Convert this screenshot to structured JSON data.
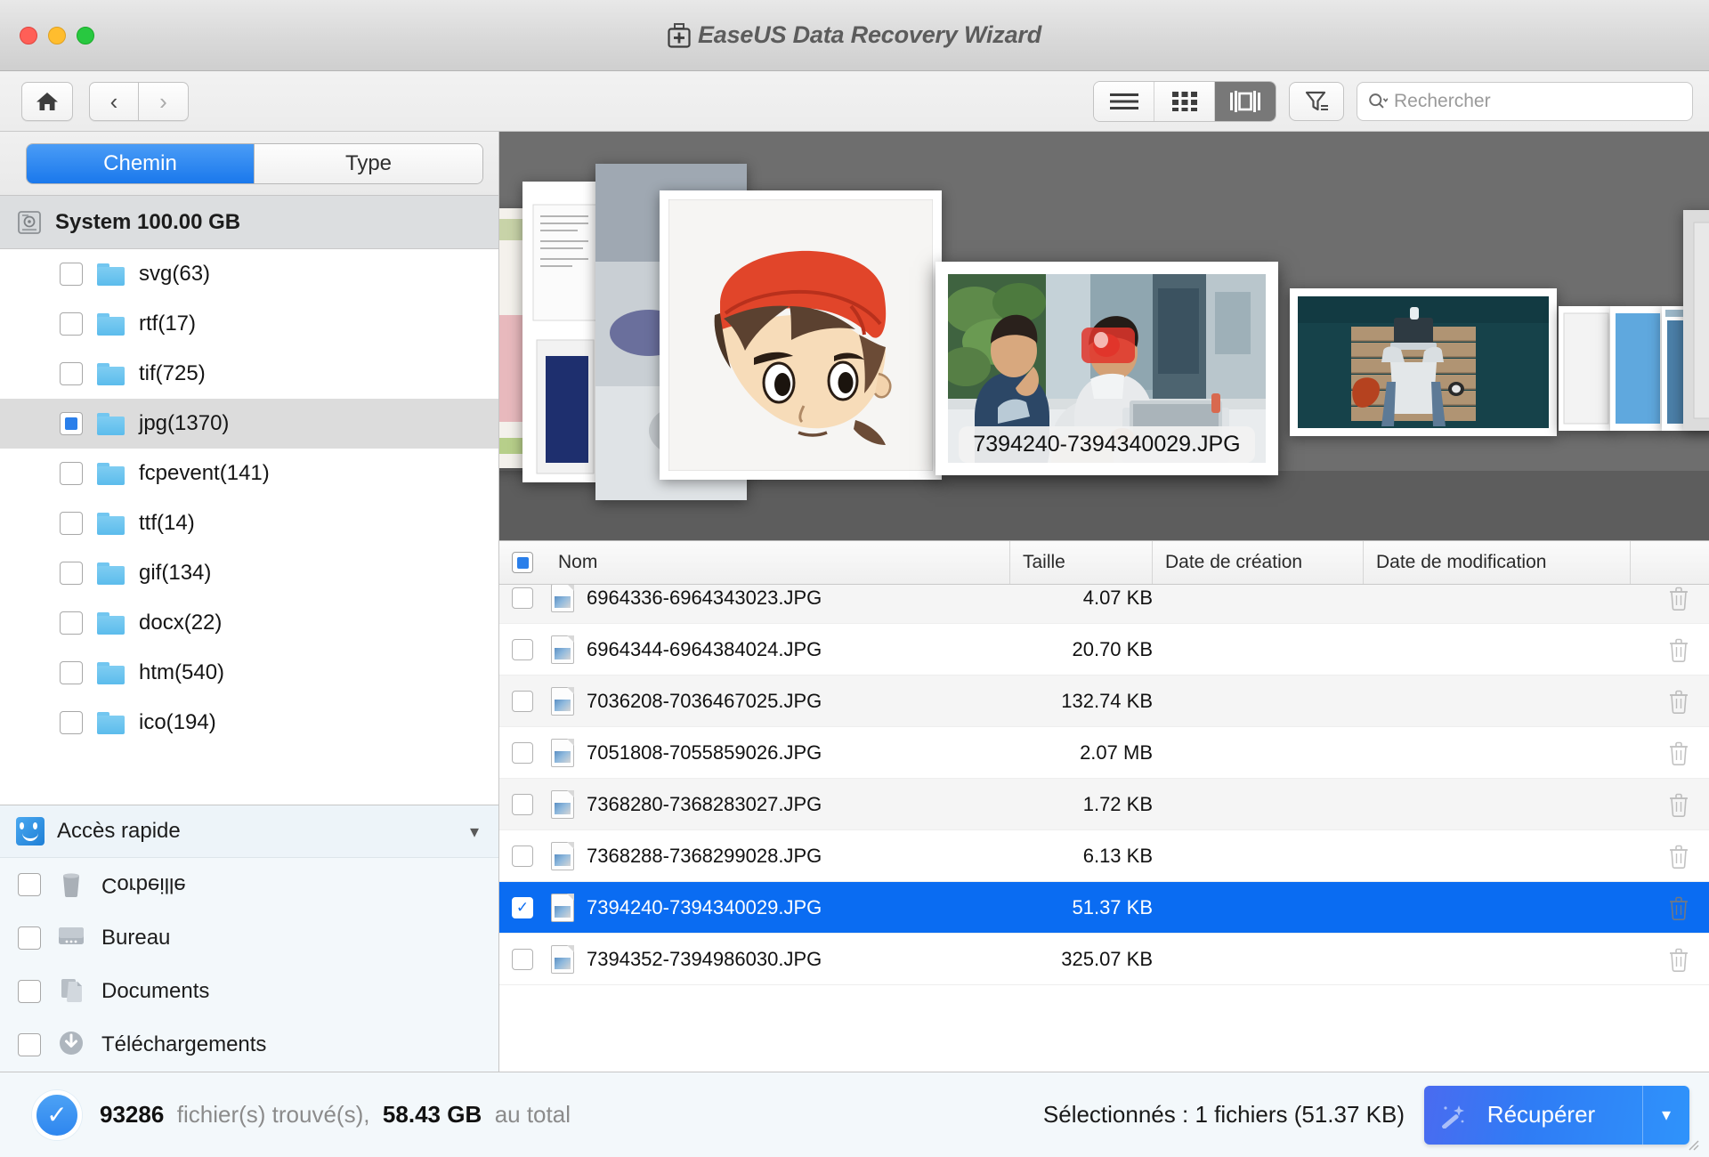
{
  "window": {
    "title": "EaseUS Data Recovery Wizard",
    "title_icon": "first-aid-kit-icon",
    "traffic_lights": [
      "close",
      "minimize",
      "maximize"
    ]
  },
  "toolbar": {
    "home_icon": "home-icon",
    "back_icon": "chevron-left-icon",
    "forward_icon": "chevron-right-icon",
    "view_modes": [
      {
        "id": "list",
        "icon": "list-view-icon",
        "active": false
      },
      {
        "id": "grid",
        "icon": "grid-view-icon",
        "active": false
      },
      {
        "id": "coverflow",
        "icon": "coverflow-view-icon",
        "active": true
      }
    ],
    "filter_icon": "filter-icon",
    "search": {
      "icon": "search-icon",
      "placeholder": "Rechercher",
      "value": ""
    }
  },
  "sidebar": {
    "tabs": [
      {
        "label": "Chemin",
        "active": true
      },
      {
        "label": "Type",
        "active": false
      }
    ],
    "drive": {
      "icon": "hard-drive-icon",
      "label": "System 100.00 GB"
    },
    "tree_items": [
      {
        "label": "svg(63)",
        "checked": "none",
        "selected": false
      },
      {
        "label": "rtf(17)",
        "checked": "none",
        "selected": false
      },
      {
        "label": "tif(725)",
        "checked": "none",
        "selected": false
      },
      {
        "label": "jpg(1370)",
        "checked": "partial",
        "selected": true
      },
      {
        "label": "fcpevent(141)",
        "checked": "none",
        "selected": false
      },
      {
        "label": "ttf(14)",
        "checked": "none",
        "selected": false
      },
      {
        "label": "gif(134)",
        "checked": "none",
        "selected": false
      },
      {
        "label": "docx(22)",
        "checked": "none",
        "selected": false
      },
      {
        "label": "htm(540)",
        "checked": "none",
        "selected": false
      },
      {
        "label": "ico(194)",
        "checked": "none",
        "selected": false
      }
    ],
    "quick_access": {
      "icon": "finder-icon",
      "label": "Accès rapide",
      "caret": "chevron-down-icon",
      "items": [
        {
          "label": "Corbeille",
          "icon": "trash-icon",
          "checked": false,
          "flipped": true
        },
        {
          "label": "Bureau",
          "icon": "desktop-icon",
          "checked": false,
          "flipped": false
        },
        {
          "label": "Documents",
          "icon": "documents-icon",
          "checked": false,
          "flipped": false
        },
        {
          "label": "Téléchargements",
          "icon": "downloads-icon",
          "checked": false,
          "flipped": false
        }
      ]
    }
  },
  "preview": {
    "selected_filename": "7394240-7394340029.JPG",
    "background_color": "#6e6e6e"
  },
  "filelist": {
    "columns": [
      "Nom",
      "Taille",
      "Date de création",
      "Date de modification"
    ],
    "header_checkbox": "partial",
    "rows": [
      {
        "name": "6964336-6964343023.JPG",
        "size": "4.07 KB",
        "created": "",
        "modified": "",
        "checked": false,
        "selected": false
      },
      {
        "name": "6964344-6964384024.JPG",
        "size": "20.70 KB",
        "created": "",
        "modified": "",
        "checked": false,
        "selected": false
      },
      {
        "name": "7036208-7036467025.JPG",
        "size": "132.74 KB",
        "created": "",
        "modified": "",
        "checked": false,
        "selected": false
      },
      {
        "name": "7051808-7055859026.JPG",
        "size": "2.07 MB",
        "created": "",
        "modified": "",
        "checked": false,
        "selected": false
      },
      {
        "name": "7368280-7368283027.JPG",
        "size": "1.72 KB",
        "created": "",
        "modified": "",
        "checked": false,
        "selected": false
      },
      {
        "name": "7368288-7368299028.JPG",
        "size": "6.13 KB",
        "created": "",
        "modified": "",
        "checked": false,
        "selected": false
      },
      {
        "name": "7394240-7394340029.JPG",
        "size": "51.37 KB",
        "created": "",
        "modified": "",
        "checked": true,
        "selected": true
      },
      {
        "name": "7394352-7394986030.JPG",
        "size": "325.07 KB",
        "created": "",
        "modified": "",
        "checked": false,
        "selected": false
      }
    ],
    "row_action_icon": "trash-icon"
  },
  "statusbar": {
    "check_icon": "check-circle-icon",
    "found_count": "93286",
    "found_label": "fichier(s) trouvé(s),",
    "total_size": "58.43",
    "total_unit": "GB",
    "total_label": "au total",
    "selection_text": "Sélectionnés : 1 fichiers (51.37 KB)",
    "recover_label": "Récupérer",
    "recover_icon": "magic-wand-icon",
    "recover_caret": "chevron-down-icon",
    "accent_color": "#2f7cf5"
  }
}
